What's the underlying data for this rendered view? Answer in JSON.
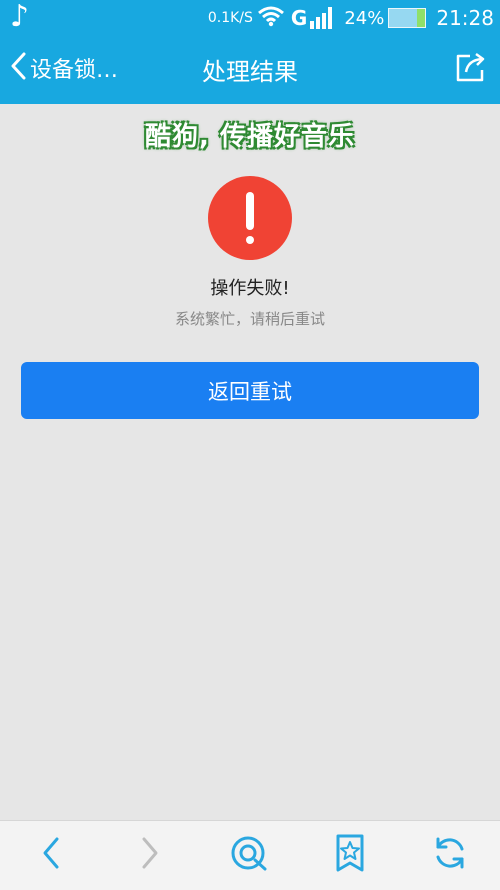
{
  "status_bar": {
    "speed": "0.1K/S",
    "network": "G",
    "battery": "24%",
    "time": "21:28",
    "icons": [
      "music-note-icon",
      "wifi-icon",
      "signal-icon",
      "battery-icon"
    ]
  },
  "nav": {
    "back_label": "设备锁…",
    "title": "处理结果",
    "icons": [
      "back-chevron-icon",
      "share-icon"
    ]
  },
  "banner": {
    "text": "酷狗, 传播好音乐"
  },
  "result": {
    "icon": "alert-icon",
    "title": "操作失败!",
    "subtitle": "系统繁忙，请稍后重试",
    "button_label": "返回重试"
  },
  "bottom_bar": {
    "icons": [
      "back-arrow-icon",
      "forward-arrow-icon",
      "browser-icon",
      "bookmark-star-icon",
      "refresh-icon"
    ]
  },
  "colors": {
    "header": "#18a8e0",
    "background": "#e6e6e6",
    "button": "#1a7ff2",
    "alert": "#f04334",
    "icon_bottom": "#2aa7e0"
  }
}
